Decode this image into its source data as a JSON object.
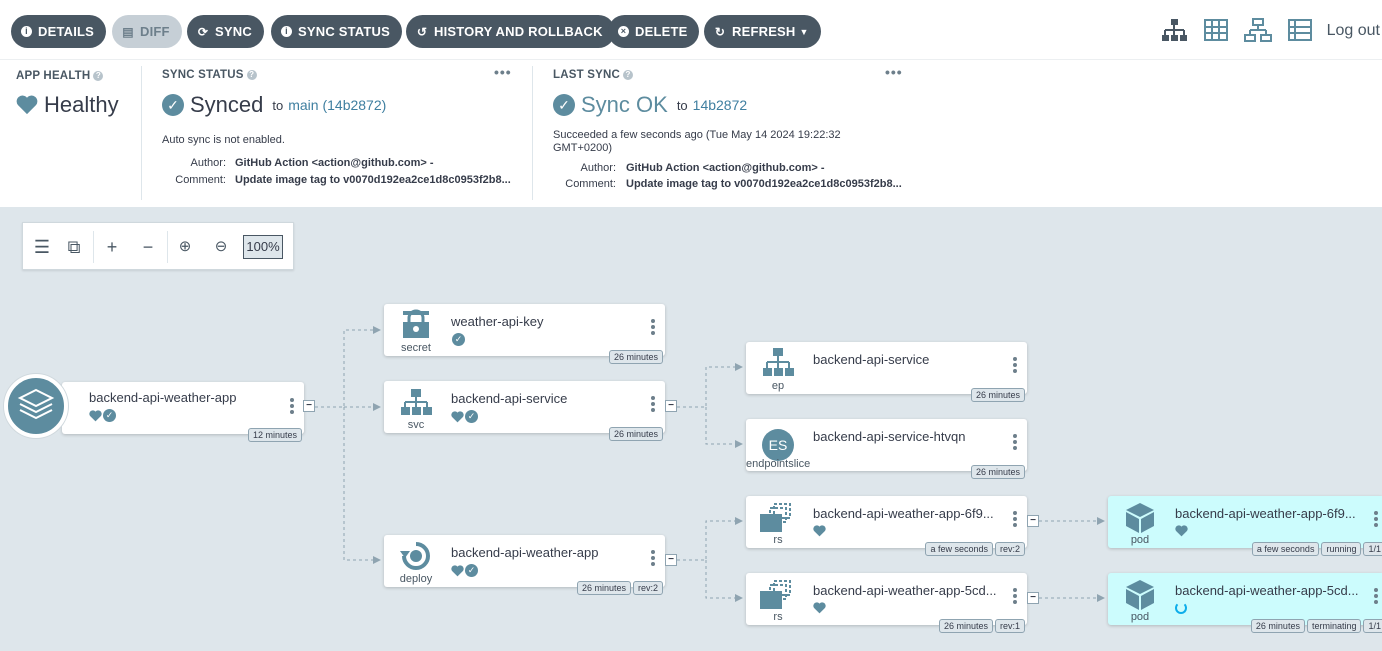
{
  "toolbar": {
    "buttons": [
      {
        "label": "DETAILS",
        "icon": "info-circle-icon"
      },
      {
        "label": "DIFF",
        "icon": "file-icon"
      },
      {
        "label": "SYNC",
        "icon": "sync-icon"
      },
      {
        "label": "SYNC STATUS",
        "icon": "info-circle-icon"
      },
      {
        "label": "HISTORY AND ROLLBACK",
        "icon": "history-icon"
      },
      {
        "label": "DELETE",
        "icon": "times-circle-icon"
      },
      {
        "label": "REFRESH",
        "icon": "redo-icon"
      }
    ],
    "logout": "Log out"
  },
  "status": {
    "app_health": {
      "label": "APP HEALTH",
      "value": "Healthy"
    },
    "sync_status": {
      "label": "SYNC STATUS",
      "value": "Synced",
      "to": "to",
      "target": "main (14b2872)",
      "note": "Auto sync is not enabled.",
      "author_key": "Author:",
      "author": "GitHub Action <action@github.com> -",
      "comment_key": "Comment:",
      "comment": "Update image tag to v0070d192ea2ce1d8c0953f2b8..."
    },
    "last_sync": {
      "label": "LAST SYNC",
      "value": "Sync OK",
      "to": "to",
      "target": "14b2872",
      "note_line1": "Succeeded a few seconds ago (Tue May 14 2024 19:22:32",
      "note_line2": "GMT+0200)",
      "author_key": "Author:",
      "author": "GitHub Action <action@github.com> -",
      "comment_key": "Comment:",
      "comment": "Update image tag to v0070d192ea2ce1d8c0953f2b8..."
    }
  },
  "zoom": {
    "value": "100%"
  },
  "nodes": {
    "root": {
      "name": "backend-api-weather-app",
      "age": "12 minutes"
    },
    "secret": {
      "name": "weather-api-key",
      "kind": "secret",
      "age": "26 minutes"
    },
    "svc": {
      "name": "backend-api-service",
      "kind": "svc",
      "age": "26 minutes"
    },
    "deploy": {
      "name": "backend-api-weather-app",
      "kind": "deploy",
      "age": "26 minutes",
      "rev": "rev:2"
    },
    "ep": {
      "name": "backend-api-service",
      "kind": "ep",
      "age": "26 minutes"
    },
    "es": {
      "name": "backend-api-service-htvqn",
      "kind": "endpointslice",
      "badge": "ES",
      "age": "26 minutes"
    },
    "rs1": {
      "name": "backend-api-weather-app-6f9...",
      "kind": "rs",
      "age": "a few seconds",
      "rev": "rev:2"
    },
    "rs2": {
      "name": "backend-api-weather-app-5cd...",
      "kind": "rs",
      "age": "26 minutes",
      "rev": "rev:1"
    },
    "pod1": {
      "name": "backend-api-weather-app-6f9...",
      "kind": "pod",
      "age": "a few seconds",
      "state": "running",
      "count": "1/1"
    },
    "pod2": {
      "name": "backend-api-weather-app-5cd...",
      "kind": "pod",
      "age": "26 minutes",
      "state": "terminating",
      "count": "1/1"
    }
  }
}
